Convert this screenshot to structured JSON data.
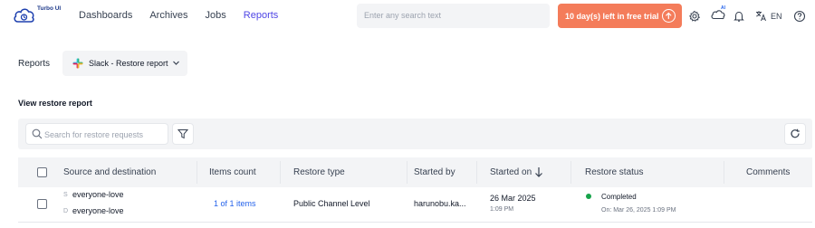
{
  "app": {
    "name": "Turbo UI"
  },
  "nav": {
    "items": [
      "Dashboards",
      "Archives",
      "Jobs",
      "Reports"
    ],
    "active": "Reports"
  },
  "header": {
    "search_placeholder": "Enter any search text",
    "trial_label": "10 day(s) left in free trial",
    "ai_badge": "AI",
    "language": "EN",
    "icons": [
      "gear-icon",
      "cloud-ai-icon",
      "bell-icon",
      "translate-icon",
      "help-icon"
    ]
  },
  "reports": {
    "label": "Reports",
    "selected": "Slack - Restore report"
  },
  "view": {
    "title": "View restore report"
  },
  "toolbar": {
    "search_placeholder": "Search for restore requests"
  },
  "table": {
    "headers": [
      "Source and destination",
      "Items count",
      "Restore type",
      "Started by",
      "Started on",
      "Restore status",
      "Comments"
    ],
    "rows": [
      {
        "source_tag": "S",
        "source": "everyone-love",
        "destination_tag": "D",
        "destination": "everyone-love",
        "items_count": "1 of 1 items",
        "restore_type": "Public Channel Level",
        "started_by": "harunobu.ka...",
        "started_on_date": "26 Mar 2025",
        "started_on_time": "1:09 PM",
        "status": "Completed",
        "status_detail": "On: Mar 26, 2025 1:09 PM",
        "comments": ""
      }
    ]
  },
  "colors": {
    "accent": "#4f46e5",
    "trial": "#f47c5a",
    "status_completed": "#16a34a",
    "link": "#2563eb"
  }
}
